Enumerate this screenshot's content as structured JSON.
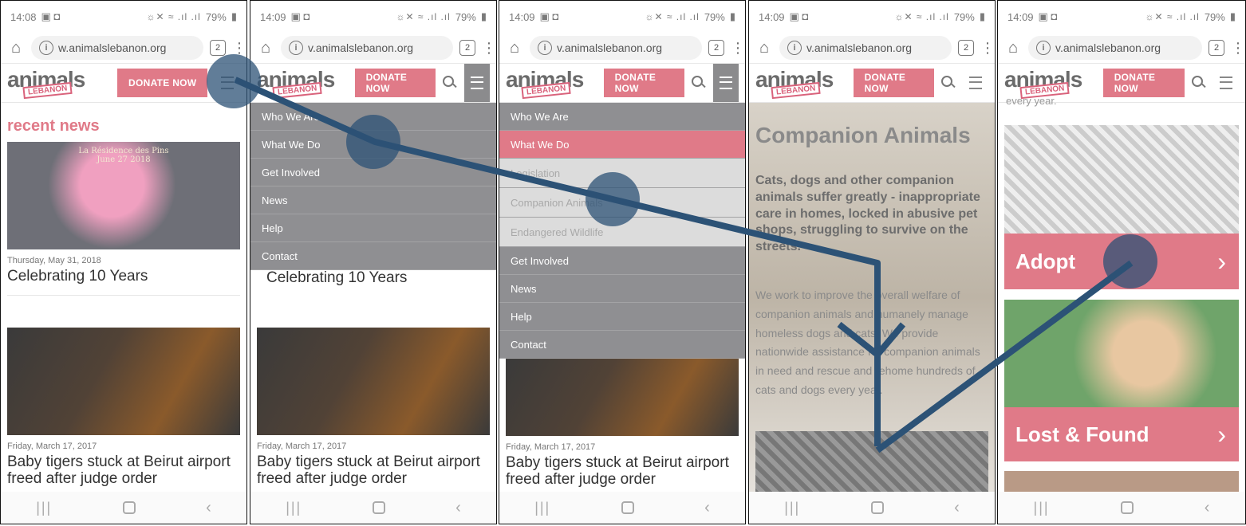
{
  "status": {
    "icons": "☼✕ ≈ .ıl .ıl",
    "battery": "79%",
    "times": [
      "14:08",
      "14:09",
      "14:09",
      "14:09",
      "14:09"
    ]
  },
  "browser": {
    "url": "w.animalslebanon.org",
    "url_alt": "v.animalslebanon.org",
    "tab_count": "2"
  },
  "site": {
    "logo_main": "animals",
    "logo_sub": "LEBANON",
    "donate_label": "DONATE NOW",
    "section_title": "recent news"
  },
  "news": [
    {
      "date": "Thursday, May 31, 2018",
      "title": "Celebrating 10 Years",
      "image_caption": "La Résidence des Pins\nJune 27 2018"
    },
    {
      "date": "Friday, March 17, 2017",
      "title": "Baby tigers stuck at Beirut airport freed after judge order"
    }
  ],
  "menu": {
    "items": [
      "Who We Are",
      "What We Do",
      "Get Involved",
      "News",
      "Help",
      "Contact"
    ],
    "submenu": [
      "Legislation",
      "Companion Animals",
      "Endangered Wildlife"
    ]
  },
  "companion": {
    "title": "Companion Animals",
    "lead": "Cats, dogs and other companion animals suffer greatly - inappropriate care in homes, locked in abusive pet shops, struggling to survive on the streets.",
    "body": "We work to improve the overall welfare of companion animals and humanely manage homeless dogs and cats. We provide nationwide assistance for companion animals in need and rescue and rehome hundreds of cats and dogs every year."
  },
  "adopt_page": {
    "top_text": "every year.",
    "blocks": [
      "Adopt",
      "Lost & Found"
    ]
  },
  "colors": {
    "accent": "#e07a88",
    "menu_bg": "#8f8f92",
    "annotation": "#2c5276"
  }
}
